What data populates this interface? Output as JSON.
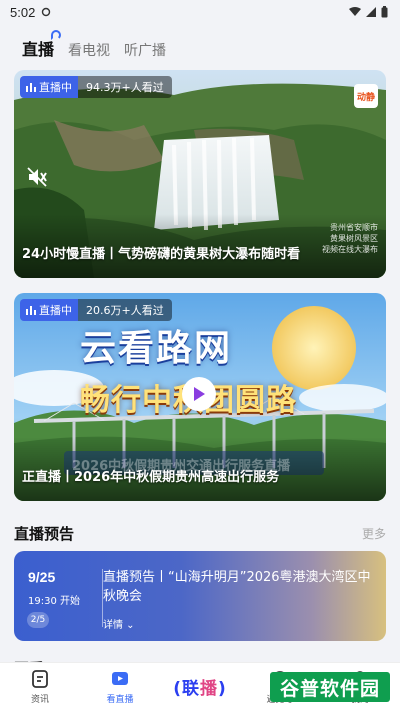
{
  "status": {
    "time": "5:02"
  },
  "tabs": [
    {
      "label": "直播",
      "active": true
    },
    {
      "label": "看电视",
      "active": false
    },
    {
      "label": "听广播",
      "active": false
    }
  ],
  "cards": [
    {
      "badge": "直播中",
      "viewers": "94.3万+人看过",
      "title": "24小时慢直播丨气势磅礴的黄果树大瀑布随时看",
      "corner_logo": "动静",
      "watermark": [
        "贵州省安顺市",
        "黄果树风景区",
        "视频在线大瀑布"
      ]
    },
    {
      "badge": "直播中",
      "viewers": "20.6万+人看过",
      "poster_line1": "云看路网",
      "poster_line2": "畅行中秋团圆路",
      "poster_ghost": "2026中秋假期贵州交通出行服务直播",
      "title": "正直播丨2026年中秋假期贵州高速出行服务"
    }
  ],
  "section": {
    "title": "直播预告",
    "more": "更多"
  },
  "preview": {
    "date": "9/25",
    "time": "19:30 开始",
    "page": "2/5",
    "desc": "直播预告丨“山海升明月”2026粤港澳大湾区中秋晚会",
    "detail": "详情"
  },
  "next_section": {
    "title": "回看"
  },
  "bottom_nav": [
    {
      "label": "资讯",
      "active": false
    },
    {
      "label": "看直播",
      "active": true
    },
    {
      "label_a": "联",
      "label_b": "播"
    },
    {
      "label": "遇见号",
      "active": false
    },
    {
      "label": "我的",
      "active": false
    }
  ],
  "corner_watermark": "谷普软件园",
  "colors": {
    "accent": "#3b6cf5",
    "live_badge": "#3d63e8",
    "watermark_green": "#0f9e4f"
  }
}
